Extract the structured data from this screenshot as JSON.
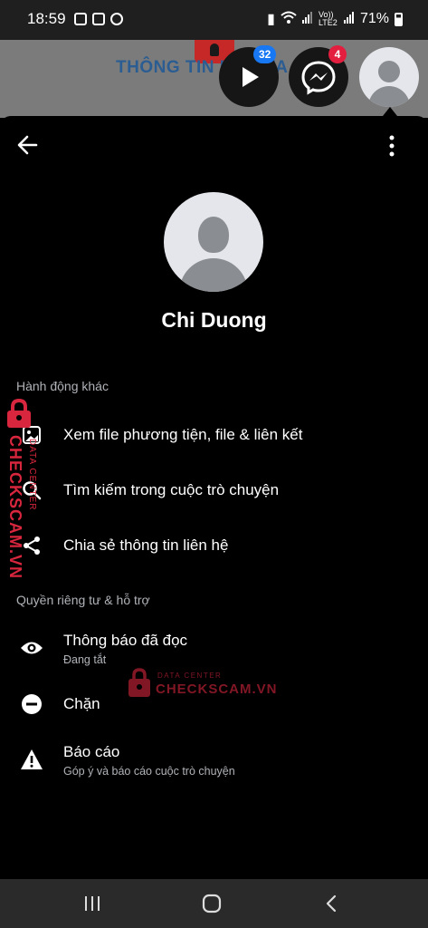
{
  "status_bar": {
    "time": "18:59",
    "carrier_small": "Vo)) LTE2",
    "battery": "71%"
  },
  "background_page": {
    "title": "THÔNG TIN KẺ LỪA ĐẢO"
  },
  "chat_heads": [
    {
      "name": "video-bubble",
      "badge": "32"
    },
    {
      "name": "messenger-bubble",
      "badge": "4"
    },
    {
      "name": "profile-bubble",
      "badge": ""
    }
  ],
  "profile": {
    "name": "Chi Duong"
  },
  "sections": {
    "more_actions": "Hành động khác",
    "privacy_support": "Quyền riêng tư & hỗ trợ"
  },
  "menu": {
    "view_media": "Xem file phương tiện, file & liên kết",
    "search_chat": "Tìm kiếm trong cuộc trò chuyện",
    "share_contact": "Chia sẻ thông tin liên hệ",
    "read_receipts": "Thông báo đã đọc",
    "read_receipts_status": "Đang tắt",
    "block": "Chặn",
    "report": "Báo cáo",
    "report_sub": "Góp ý và báo cáo cuộc trò chuyện"
  },
  "watermark": {
    "brand": "CHECKSCAM.VN",
    "tag": "DATA CENTER"
  },
  "colors": {
    "sheet_bg": "#000000",
    "secondary_text": "#b0b3b8",
    "badge_blue": "#1877f2",
    "badge_red": "#e41e3f",
    "watermark_red": "#d7263d"
  }
}
